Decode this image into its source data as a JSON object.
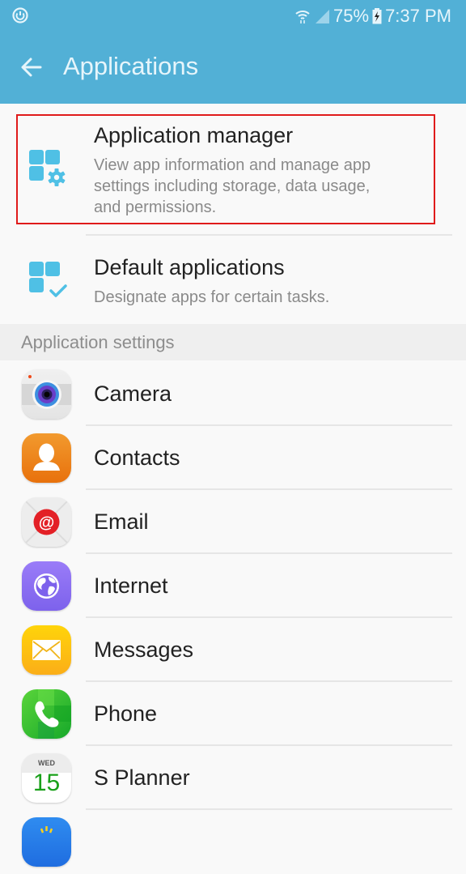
{
  "status_bar": {
    "battery": "75%",
    "time": "7:37 PM",
    "icons": [
      "sync-icon",
      "wifi-icon",
      "signal-icon",
      "battery-charging-icon"
    ]
  },
  "app_bar": {
    "title": "Applications",
    "back_icon": "arrow-back-icon"
  },
  "main_items": [
    {
      "title": "Application manager",
      "subtitle_lines": [
        "View app information and manage app",
        "settings including storage, data usage,",
        "and permissions."
      ],
      "icon": "app-manager-gear-icon",
      "highlighted": true
    },
    {
      "title": "Default applications",
      "subtitle_lines": [
        "Designate apps for certain tasks."
      ],
      "icon": "default-apps-check-icon"
    }
  ],
  "section": {
    "header": "Application settings"
  },
  "apps": [
    {
      "label": "Camera",
      "icon": "camera-icon"
    },
    {
      "label": "Contacts",
      "icon": "contacts-icon"
    },
    {
      "label": "Email",
      "icon": "email-icon"
    },
    {
      "label": "Internet",
      "icon": "internet-icon"
    },
    {
      "label": "Messages",
      "icon": "messages-icon"
    },
    {
      "label": "Phone",
      "icon": "phone-icon"
    },
    {
      "label": "S Planner",
      "icon": "calendar-icon",
      "calendar_day": "WED",
      "calendar_date": "15"
    }
  ],
  "colors": {
    "accent": "#52b0d6",
    "icon_blue": "#4fc0e5",
    "highlight_border": "#e01b1b"
  }
}
